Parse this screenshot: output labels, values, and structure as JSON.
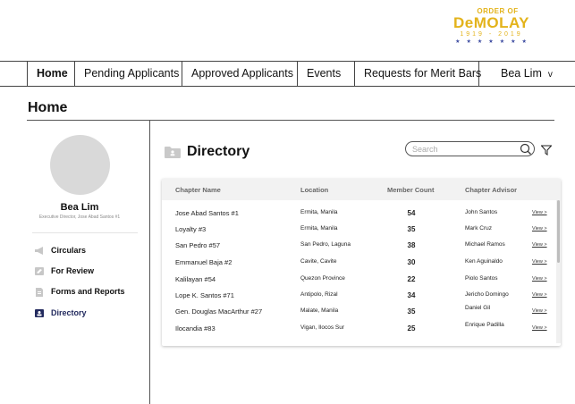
{
  "logo": {
    "line1": "ORDER OF",
    "line2": "DeMOLAY",
    "line3": "1919 - 2019",
    "stars": "★★★★★★★",
    "gold_color": "#e3b31b"
  },
  "nav": {
    "items": [
      {
        "label": "Home",
        "active": true
      },
      {
        "label": "Pending Applicants"
      },
      {
        "label": "Approved Applicants"
      },
      {
        "label": "Events"
      },
      {
        "label": "Requests for Merit Bars"
      }
    ],
    "user": {
      "label": "Bea Lim",
      "chevron": "v"
    }
  },
  "page": {
    "title": "Home"
  },
  "sidebar": {
    "name": "Bea Lim",
    "role": "Executive Director, Jose Abad Santos #1",
    "items": [
      {
        "label": "Circulars",
        "icon": "megaphone-icon"
      },
      {
        "label": "For Review",
        "icon": "review-icon"
      },
      {
        "label": "Forms and Reports",
        "icon": "document-icon"
      },
      {
        "label": "Directory",
        "icon": "directory-icon",
        "active": true,
        "color": "#222a5e"
      }
    ]
  },
  "directory": {
    "title": "Directory",
    "search_placeholder": "Search",
    "columns": [
      "Chapter Name",
      "Location",
      "Member Count",
      "Chapter Advisor"
    ],
    "rows": [
      {
        "name": "Jose Abad Santos #1",
        "location": "Ermita, Manila",
        "count": "54",
        "advisor": "John Santos",
        "view": "View >"
      },
      {
        "name": "Loyalty #3",
        "location": "Ermita, Manila",
        "count": "35",
        "advisor": "Mark Cruz",
        "view": "View >"
      },
      {
        "name": "San Pedro #57",
        "location": "San Pedro, Laguna",
        "count": "38",
        "advisor": "Michael Ramos",
        "view": "View >"
      },
      {
        "name": "Emmanuel Baja #2",
        "location": "Cavite, Cavite",
        "count": "30",
        "advisor": "Ken Aguinaldo",
        "view": "View >"
      },
      {
        "name": "Kalilayan #54",
        "location": "Quezon Province",
        "count": "22",
        "advisor": "Piolo Santos",
        "view": "View >"
      },
      {
        "name": "Lope K. Santos #71",
        "location": "Antipolo, Rizal",
        "count": "34",
        "advisor": "Jericho Domingo",
        "view": "View >"
      },
      {
        "name": "Gen. Douglas MacArthur #27",
        "location": "Malate, Manila",
        "count": "35",
        "advisor": "Daniel Gil",
        "view": "View >"
      },
      {
        "name": "Ilocandia #83",
        "location": "Vigan, Ilocos Sur",
        "count": "25",
        "advisor": "Enrique Padilla",
        "view": "View >"
      }
    ]
  }
}
